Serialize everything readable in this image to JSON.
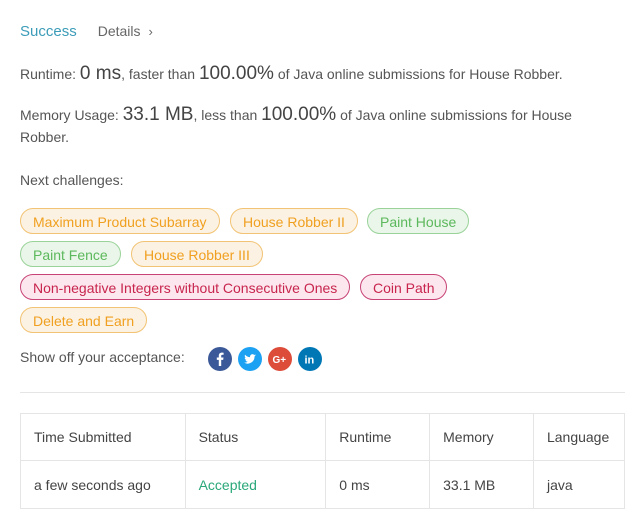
{
  "result": {
    "status": "Success",
    "details_label": "Details",
    "details_chevron": "›"
  },
  "runtime": {
    "prefix": "Runtime: ",
    "value": "0 ms",
    "mid": ", faster than ",
    "percent": "100.00%",
    "suffix": " of Java online submissions for House Robber."
  },
  "memory": {
    "prefix": "Memory Usage: ",
    "value": "33.1 MB",
    "mid": ", less than ",
    "percent": "100.00%",
    "suffix": " of Java online submissions for House Robber."
  },
  "next_challenges": {
    "title": "Next challenges:",
    "items": [
      {
        "label": "Maximum Product Subarray",
        "difficulty": "medium"
      },
      {
        "label": "House Robber II",
        "difficulty": "medium"
      },
      {
        "label": "Paint House",
        "difficulty": "easy"
      },
      {
        "label": "Paint Fence",
        "difficulty": "easy"
      },
      {
        "label": "House Robber III",
        "difficulty": "medium"
      },
      {
        "label": "Non-negative Integers without Consecutive Ones",
        "difficulty": "hard"
      },
      {
        "label": "Coin Path",
        "difficulty": "hard"
      },
      {
        "label": "Delete and Earn",
        "difficulty": "medium"
      }
    ]
  },
  "share": {
    "label": "Show off your acceptance:",
    "icons": [
      {
        "name": "facebook-icon",
        "color": "#3b5998"
      },
      {
        "name": "twitter-icon",
        "color": "#1da1f2"
      },
      {
        "name": "google-plus-icon",
        "color": "#dd4b39"
      },
      {
        "name": "linkedin-icon",
        "color": "#0077b5"
      }
    ]
  },
  "table": {
    "headers": [
      "Time Submitted",
      "Status",
      "Runtime",
      "Memory",
      "Language"
    ],
    "rows": [
      {
        "time": "a few seconds ago",
        "status": "Accepted",
        "runtime": "0 ms",
        "memory": "33.1 MB",
        "language": "java"
      }
    ]
  },
  "colors": {
    "success": "#3c9cb8",
    "accepted": "#2aa87a",
    "medium": "#f0a020",
    "easy": "#5cb85c",
    "hard": "#c7254e"
  }
}
